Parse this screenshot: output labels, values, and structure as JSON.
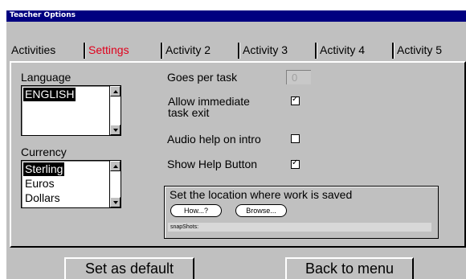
{
  "window": {
    "title": "Teacher Options"
  },
  "tabs": [
    {
      "label": "Activities",
      "active": false
    },
    {
      "label": "Settings",
      "active": true
    },
    {
      "label": "Activity 2",
      "active": false
    },
    {
      "label": "Activity 3",
      "active": false
    },
    {
      "label": "Activity 4",
      "active": false
    },
    {
      "label": "Activity 5",
      "active": false
    }
  ],
  "language": {
    "label": "Language",
    "items": [
      "ENGLISH"
    ],
    "selected": "ENGLISH"
  },
  "currency": {
    "label": "Currency",
    "items": [
      "Sterling",
      "Euros",
      "Dollars"
    ],
    "selected": "Sterling"
  },
  "settings": {
    "goes_per_task": {
      "label": "Goes per task",
      "value": "0"
    },
    "allow_exit": {
      "label_line1": "Allow immediate",
      "label_line2": "task exit",
      "checked": true
    },
    "audio_help": {
      "label": "Audio help on intro",
      "checked": false
    },
    "show_help": {
      "label": "Show Help Button",
      "checked": true
    }
  },
  "save_location": {
    "title": "Set the location where work is saved",
    "how_label": "How...?",
    "browse_label": "Browse...",
    "path": "snapShots:"
  },
  "footer": {
    "default_label": "Set as default",
    "back_label": "Back to menu"
  },
  "colors": {
    "titlebar": "#000080",
    "active_tab": "#e0001c",
    "window_bg": "#c0c0c0"
  }
}
